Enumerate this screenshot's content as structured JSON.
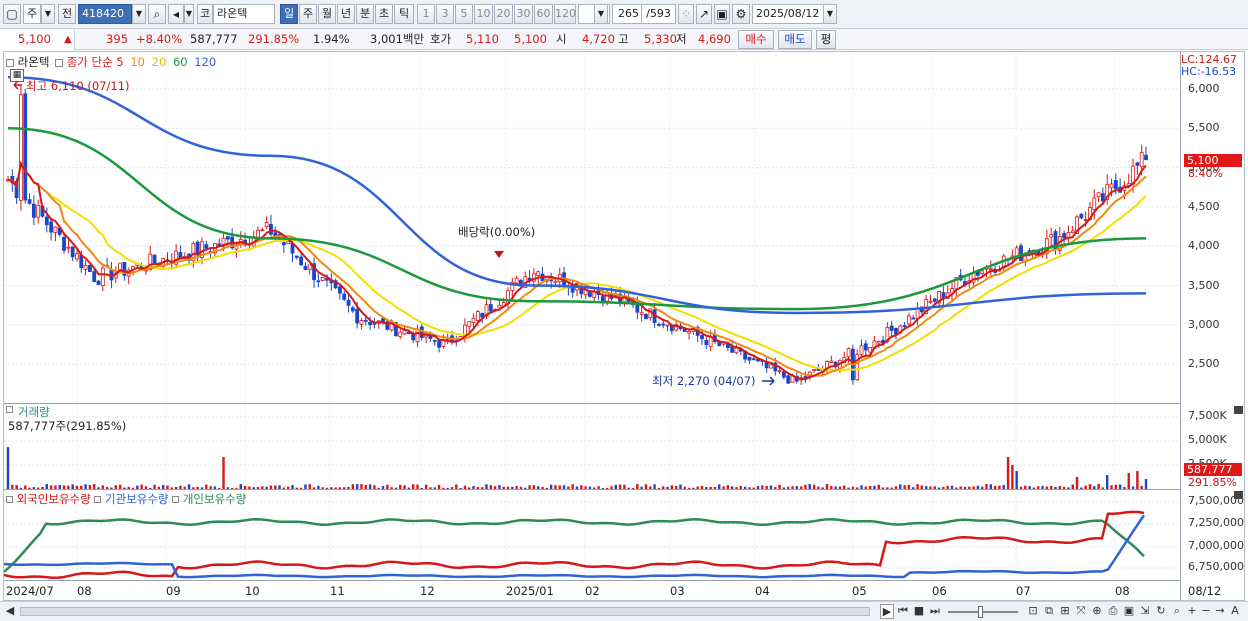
{
  "toolbar": {
    "period_main": "주",
    "prev_label": "전",
    "code": "418420",
    "market_label": "코",
    "name": "라온텍",
    "periods": [
      "일",
      "주",
      "월",
      "년",
      "분",
      "초",
      "틱"
    ],
    "active_period": "일",
    "intervals": [
      "1",
      "3",
      "5",
      "10",
      "20",
      "30",
      "60",
      "120"
    ],
    "count": "265",
    "total": "/593",
    "date": "2025/08/12"
  },
  "quote": {
    "price": "5,100",
    "arrow": "▲",
    "change": "395",
    "change_pct": "+8.40%",
    "volume": "587,777",
    "volume_pct": "291.85%",
    "turnover": "1.94%",
    "amount": "3,001백만",
    "bid_label": "호가",
    "bid1": "5,110",
    "bid2": "5,100",
    "open_label": "시",
    "open": "4,720",
    "high_label": "고",
    "high": "5,330",
    "low_label": "저",
    "low": "4,690",
    "buy": "매수",
    "sell": "매도",
    "eval": "평"
  },
  "legend": {
    "name": "라온텍",
    "main": "종가 단순",
    "ma": [
      {
        "period": "5",
        "color": "#e02020"
      },
      {
        "period": "10",
        "color": "#f08a10"
      },
      {
        "period": "20",
        "color": "#e8d800"
      },
      {
        "period": "60",
        "color": "#1a9a3a"
      },
      {
        "period": "120",
        "color": "#2f63d8"
      }
    ]
  },
  "price_pane": {
    "lc": "LC:124.67",
    "hc": "HC:-16.53",
    "y_ticks": [
      "6,000",
      "5,500",
      "5,000",
      "4,500",
      "4,000",
      "3,500",
      "3,000",
      "2,500"
    ],
    "current_price": "5,100",
    "current_pct": "8.40%",
    "high_annotation": "최고 6,110 (07/11)",
    "low_annotation": "최저 2,270 (04/07)",
    "dividend": "배당락(0.00%)"
  },
  "volume_pane": {
    "title": "거래량",
    "value": "587,777주(291.85%)",
    "y_ticks": [
      "7,500K",
      "5,000K",
      "2,500K"
    ],
    "current": "587,777",
    "current_pct": "291.85%"
  },
  "holding_pane": {
    "legend": [
      {
        "label": "외국인보유수량",
        "color": "#d81818"
      },
      {
        "label": "기관보유수량",
        "color": "#2f63d8"
      },
      {
        "label": "개인보유수량",
        "color": "#2e8b57"
      }
    ],
    "y_ticks": [
      "7,500,000",
      "7,250,000",
      "7,000,000",
      "6,750,000"
    ]
  },
  "x_axis": {
    "labels": [
      "2024/07",
      "08",
      "09",
      "10",
      "11",
      "12",
      "2025/01",
      "02",
      "03",
      "04",
      "05",
      "06",
      "07",
      "08"
    ],
    "right_label": "08/12"
  },
  "chart_data": {
    "type": "candlestick",
    "period": "daily",
    "y_range": [
      2100,
      6300
    ],
    "price_ticks": [
      6000,
      5500,
      5000,
      4500,
      4000,
      3500,
      3000,
      2500
    ],
    "close_series": [
      [
        "2024/07",
        4850
      ],
      [
        "2024/08",
        3600
      ],
      [
        "2024/09",
        3900
      ],
      [
        "2024/10",
        4200
      ],
      [
        "2024/11",
        3100
      ],
      [
        "2024/12",
        2750
      ],
      [
        "2025/01",
        3700
      ],
      [
        "2025/02",
        3300
      ],
      [
        "2025/03",
        2800
      ],
      [
        "2025/04",
        2270
      ],
      [
        "2025/05",
        2850
      ],
      [
        "2025/06",
        3650
      ],
      [
        "2025/07",
        4100
      ],
      [
        "2025/08",
        5100
      ]
    ],
    "ma120": [
      [
        "2024/07",
        6150
      ],
      [
        "2024/10",
        5150
      ],
      [
        "2025/01",
        3500
      ],
      [
        "2025/04",
        3150
      ],
      [
        "2025/08",
        3400
      ]
    ],
    "ma60": [
      [
        "2024/07",
        5500
      ],
      [
        "2024/10",
        4100
      ],
      [
        "2025/01",
        3300
      ],
      [
        "2025/04",
        3200
      ],
      [
        "2025/08",
        4100
      ]
    ],
    "annotations": [
      {
        "label": "최고",
        "value": 6110,
        "date": "07/11"
      },
      {
        "label": "최저",
        "value": 2270,
        "date": "04/07"
      }
    ]
  }
}
